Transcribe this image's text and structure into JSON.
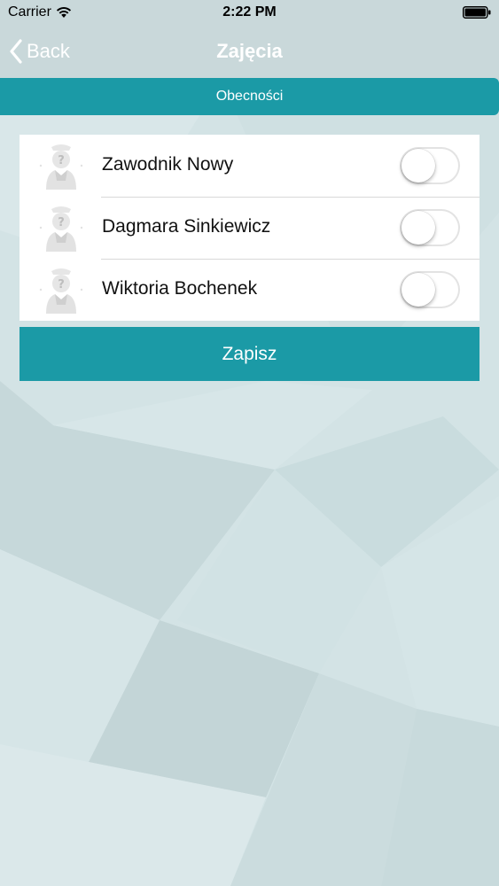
{
  "status_bar": {
    "carrier": "Carrier",
    "time": "2:22 PM"
  },
  "nav": {
    "back_label": "Back",
    "title": "Zajęcia"
  },
  "section": {
    "title": "Obecności"
  },
  "attendees": [
    {
      "name": "Zawodnik Nowy",
      "present": false
    },
    {
      "name": "Dagmara Sinkiewicz",
      "present": false
    },
    {
      "name": "Wiktoria Bochenek",
      "present": false
    }
  ],
  "actions": {
    "save_label": "Zapisz"
  },
  "colors": {
    "accent": "#1b9aa6",
    "background": "#d4e4e6"
  }
}
